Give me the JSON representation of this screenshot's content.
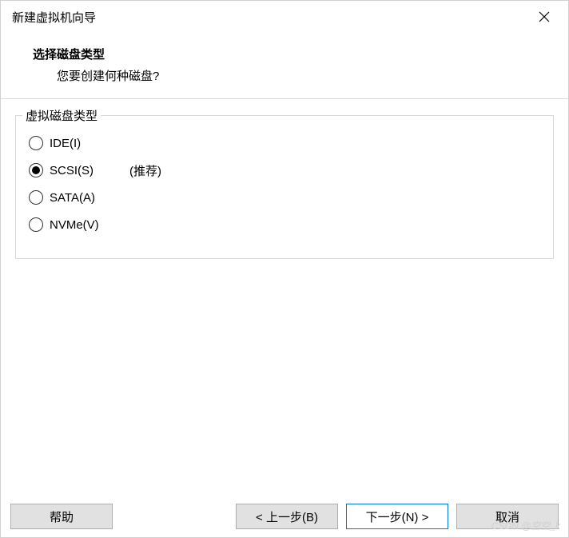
{
  "window": {
    "title": "新建虚拟机向导"
  },
  "header": {
    "title": "选择磁盘类型",
    "subtitle": "您要创建何种磁盘?"
  },
  "fieldset": {
    "legend": "虚拟磁盘类型"
  },
  "options": {
    "ide": {
      "label": "IDE(I)",
      "note": ""
    },
    "scsi": {
      "label": "SCSI(S)",
      "note": "(推荐)"
    },
    "sata": {
      "label": "SATA(A)",
      "note": ""
    },
    "nvme": {
      "label": "NVMe(V)",
      "note": ""
    }
  },
  "selected": "scsi",
  "buttons": {
    "help": "帮助",
    "back": "< 上一步(B)",
    "next": "下一步(N) >",
    "cancel": "取消"
  },
  "watermark": "CSDN @空空_k"
}
